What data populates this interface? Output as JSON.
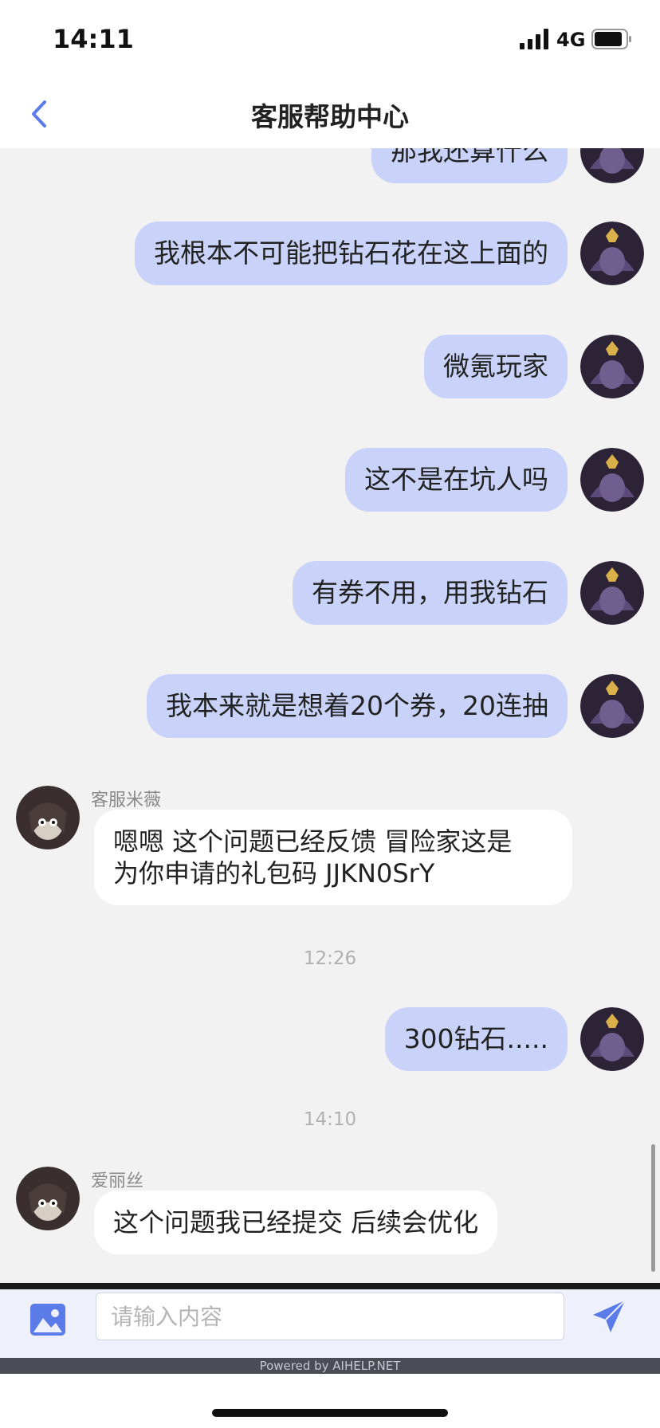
{
  "status_bar": {
    "time": "14:11",
    "network": "4G"
  },
  "header": {
    "title": "客服帮助中心"
  },
  "messages": {
    "user_partial": "那我还算什么",
    "user_1": "我根本不可能把钻石花在这上面的",
    "user_2": "微氪玩家",
    "user_3": "这不是在坑人吗",
    "user_4": "有券不用，用我钻石",
    "user_5": "我本来就是想着20个券，20连抽",
    "agent_1": {
      "name": "客服米薇",
      "line1": "嗯嗯  这个问题已经反馈  冒险家这是",
      "line2": "为你申请的礼包码  JJKN0SrY"
    },
    "time_1": "12:26",
    "user_6": "300钻石.....",
    "time_2": "14:10",
    "agent_2": {
      "name": "爱丽丝",
      "text": "这个问题我已经提交  后续会优化"
    }
  },
  "input": {
    "placeholder": "请输入内容"
  },
  "footer": {
    "powered_by": "Powered by AIHELP.NET"
  },
  "colors": {
    "user_bubble": "#c9d3f9",
    "agent_bubble": "#ffffff",
    "accent": "#5b7be8",
    "background": "#f2f2f2"
  }
}
